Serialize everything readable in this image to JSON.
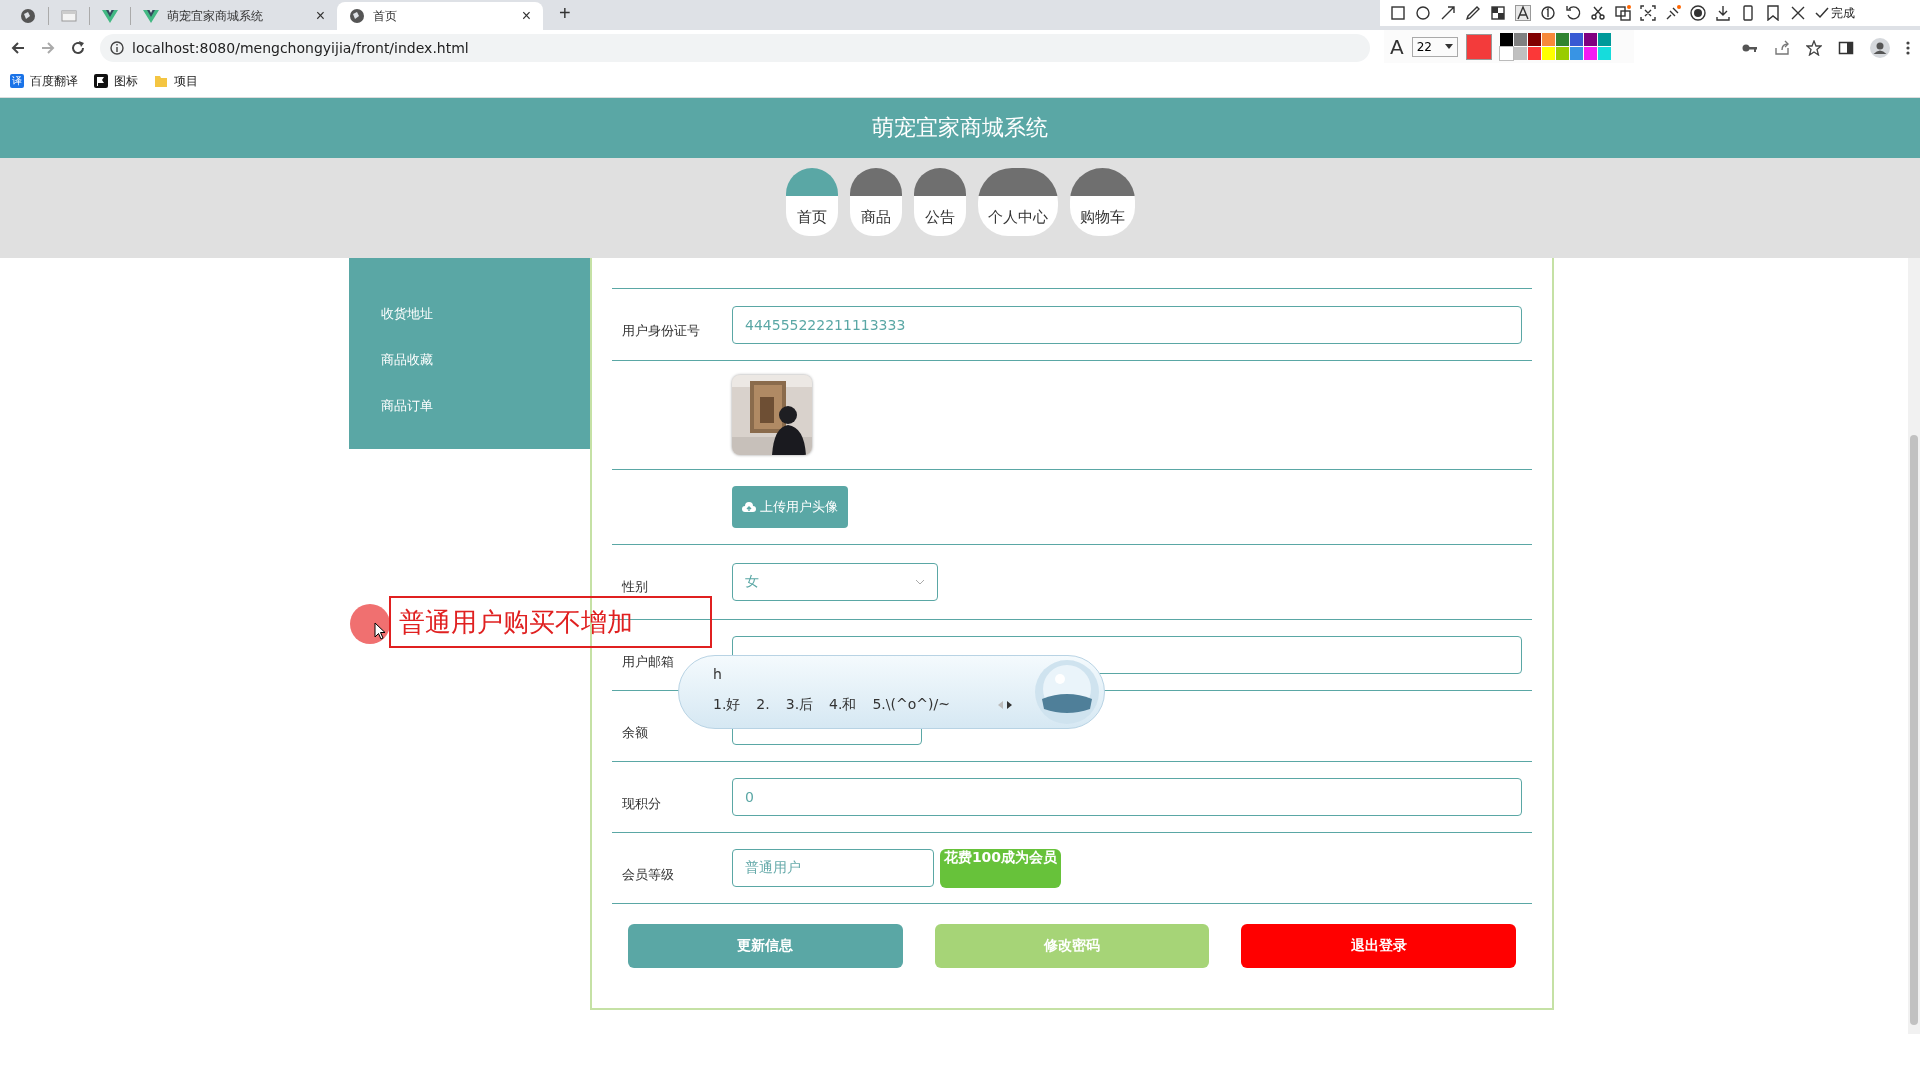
{
  "browser": {
    "tabs": [
      {
        "kind": "globe",
        "selected": false
      },
      {
        "kind": "page",
        "selected": false
      },
      {
        "kind": "vue",
        "selected": false
      },
      {
        "kind": "vue",
        "title": "萌宠宜家商城系统",
        "close": "×",
        "selected": false
      },
      {
        "kind": "globe",
        "title": "首页",
        "close": "×",
        "selected": true
      }
    ],
    "new_tab": "+",
    "address": "localhost:8080/mengchongyijia/front/index.html",
    "bookmarks": [
      {
        "kind": "translate",
        "badge": "译",
        "label": "百度翻译"
      },
      {
        "kind": "flag",
        "label": "图标"
      },
      {
        "kind": "folder",
        "label": "项目"
      }
    ]
  },
  "capture_toolbar": {
    "font_glyph": "A",
    "font_size": "22",
    "done": "完成",
    "palette": [
      {
        "color": "#000000"
      },
      {
        "color": "#808080"
      },
      {
        "color": "#800000"
      },
      {
        "color": "#f7883a"
      },
      {
        "color": "#308430"
      },
      {
        "color": "#385ad3"
      },
      {
        "color": "#800080"
      },
      {
        "color": "#009999"
      },
      {
        "color": "#ffffff"
      },
      {
        "color": "#c0c0c0"
      },
      {
        "color": "#fb3838"
      },
      {
        "color": "#ffff00"
      },
      {
        "color": "#99cc00"
      },
      {
        "color": "#3894e4"
      },
      {
        "color": "#f31bf3"
      },
      {
        "color": "#16dcdc"
      }
    ]
  },
  "site": {
    "title": "萌宠宜家商城系统",
    "nav": [
      {
        "label": "首页",
        "selected": true
      },
      {
        "label": "商品",
        "selected": false
      },
      {
        "label": "公告",
        "selected": false
      },
      {
        "label": "个人中心",
        "selected": false
      },
      {
        "label": "购物车",
        "selected": false
      }
    ],
    "sidebar": [
      {
        "label": "收货地址"
      },
      {
        "label": "商品收藏"
      },
      {
        "label": "商品订单"
      }
    ],
    "form": {
      "rows": [
        {
          "kind": "text",
          "label": "用户身份证号",
          "value": "444555222211113333"
        },
        {
          "kind": "avatar"
        },
        {
          "kind": "upload",
          "button": "上传用户头像"
        },
        {
          "kind": "select",
          "label": "性别",
          "value": "女"
        },
        {
          "kind": "text",
          "label": "用户邮箱"
        },
        {
          "kind": "short",
          "label": "余额"
        },
        {
          "kind": "text",
          "label": "现积分",
          "value": "0"
        },
        {
          "kind": "member",
          "label": "会员等级",
          "value": "普通用户",
          "button": "花费100成为会员"
        }
      ],
      "buttons": [
        {
          "label": "更新信息",
          "color": "#5aa7a5"
        },
        {
          "label": "修改密码",
          "color": "#a6d477"
        },
        {
          "label": "退出登录",
          "color": "#ff0000"
        }
      ]
    }
  },
  "annotation": {
    "text": "普通用户购买不增加"
  },
  "ime": {
    "input": "h",
    "candidates": [
      "1.好",
      "2.",
      "3.后",
      "4.和",
      "5.\\(^o^)/~"
    ]
  }
}
